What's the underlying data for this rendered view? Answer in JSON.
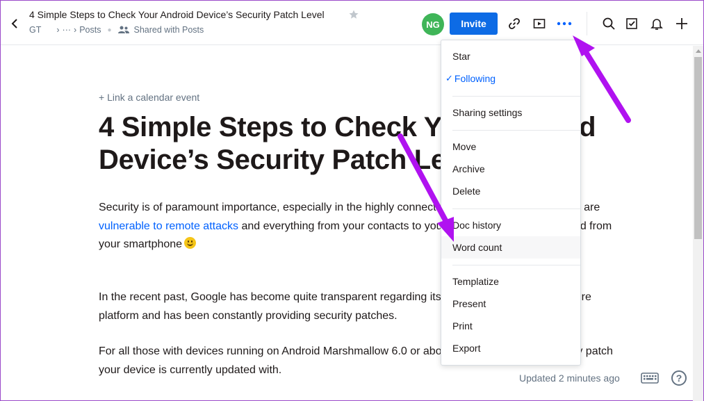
{
  "header": {
    "title": "4 Simple Steps to Check Your Android Device’s Security Patch Level",
    "breadcrumb": {
      "root": "GT",
      "ellipsis": "···",
      "folder": "Posts",
      "shared_label": "Shared with Posts"
    },
    "avatar_initials": "NG",
    "invite_label": "Invite",
    "icons": [
      "chevron-left-icon",
      "star-icon",
      "link-icon",
      "present-icon",
      "more-icon",
      "search-icon",
      "checkbox-icon",
      "bell-icon",
      "plus-icon"
    ]
  },
  "document": {
    "link_calendar": "+ Link a calendar event",
    "heading": "4  Simple Steps to Check Your Android Device’s Security Patch Level",
    "p1_before": "Security is of paramount importance, especially in the highly connected world where more devices are ",
    "p1_link": "vulnerable to remote attacks",
    "p1_after": " and everything from your contacts to your personal data can be mined from your smartphone",
    "p2": "In the recent past, Google has become quite transparent regarding its aim to make Android a secure platform and has been constantly providing security patches.",
    "p3": "For all those with devices running on Android Marshmallow 6.0 or above, can check which security patch your device is currently updated with."
  },
  "footer": {
    "updated": "Updated 2 minutes ago",
    "help": "?"
  },
  "menu": {
    "items": [
      {
        "label": "Star"
      },
      {
        "label": "Following",
        "checked": true
      },
      {
        "label": "Sharing settings"
      },
      {
        "label": "Move"
      },
      {
        "label": "Archive"
      },
      {
        "label": "Delete"
      },
      {
        "label": "Doc history"
      },
      {
        "label": "Word count",
        "highlighted": true
      },
      {
        "label": "Templatize"
      },
      {
        "label": "Present"
      },
      {
        "label": "Print"
      },
      {
        "label": "Export"
      }
    ],
    "check_glyph": "✓"
  },
  "colors": {
    "accent": "#0061fe",
    "invite": "#0d6be5",
    "avatar": "#3fb558",
    "annotation_arrow": "#b012f0"
  }
}
